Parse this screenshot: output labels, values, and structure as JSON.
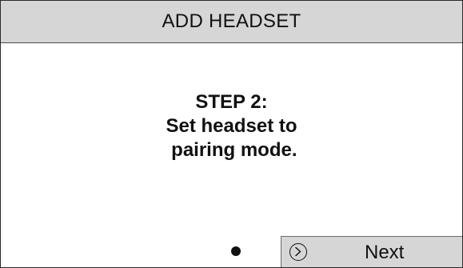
{
  "header": {
    "title": "ADD HEADSET"
  },
  "main": {
    "step_heading": "STEP 2:",
    "instruction_line1": "Set headset to",
    "instruction_line2": " pairing mode."
  },
  "pager": {
    "current_page": 1,
    "total_pages": 1
  },
  "softkey": {
    "label": "Next",
    "icon": "chevron-right-circle-icon"
  }
}
